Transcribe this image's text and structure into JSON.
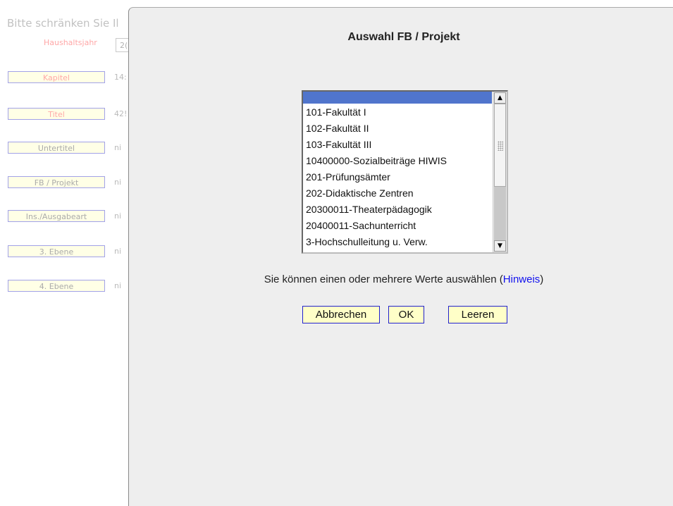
{
  "background_form": {
    "intro": "Bitte schränken Sie Il",
    "year_label": "Haushaltsjahr",
    "year_value": "2(",
    "rows": [
      {
        "label": "Kapitel",
        "value": "14:"
      },
      {
        "label": "Titel",
        "value": "42!"
      },
      {
        "label": "Untertitel",
        "value": "ni"
      },
      {
        "label": "FB / Projekt",
        "value": "ni"
      },
      {
        "label": "Ins./Ausgabeart",
        "value": "ni"
      },
      {
        "label": "3. Ebene",
        "value": "ni"
      },
      {
        "label": "4. Ebene",
        "value": "ni"
      }
    ]
  },
  "dialog": {
    "title": "Auswahl FB / Projekt",
    "list_items": [
      "",
      "101-Fakultät I",
      "102-Fakultät II",
      "103-Fakultät III",
      "10400000-Sozialbeiträge HIWIS",
      "201-Prüfungsämter",
      "202-Didaktische Zentren",
      "20300011-Theaterpädagogik",
      "20400011-Sachunterricht",
      "3-Hochschulleitung u. Verw."
    ],
    "selected_index": 0,
    "hint_text": "Sie können einen oder mehrere Werte auswählen (",
    "hint_link": "Hinweis",
    "hint_close": ")",
    "buttons": {
      "cancel": "Abbrechen",
      "ok": "OK",
      "clear": "Leeren"
    }
  },
  "colors": {
    "selection": "#5075cc",
    "button_bg": "#ffffc8",
    "button_border": "#2222cc",
    "link": "#1111ee",
    "dialog_bg": "#eeeeee"
  },
  "icons": {
    "scroll_up": "arrow-up-icon",
    "scroll_down": "arrow-down-icon"
  }
}
